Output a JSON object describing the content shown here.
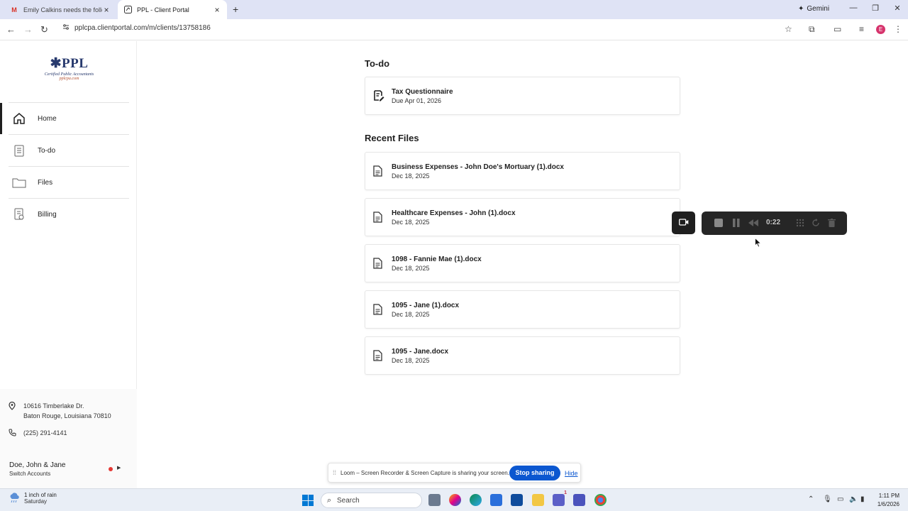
{
  "browser": {
    "tabs": [
      {
        "title": "Emily Calkins needs the followi",
        "favicon": "gmail-icon",
        "active": false
      },
      {
        "title": "PPL - Client Portal",
        "favicon": "portal-icon",
        "active": true
      }
    ],
    "gemini_label": "Gemini",
    "url": "pplcpa.clientportal.com/m/clients/13758186",
    "profile_initial": "E"
  },
  "sidebar": {
    "logo": {
      "mark": "PPL",
      "subtitle": "Certified Public Accountants",
      "site": "pplcpa.com"
    },
    "nav": [
      {
        "label": "Home",
        "icon": "home-icon",
        "active": true
      },
      {
        "label": "To-do",
        "icon": "clipboard-icon",
        "active": false
      },
      {
        "label": "Files",
        "icon": "folder-icon",
        "active": false
      },
      {
        "label": "Billing",
        "icon": "receipt-icon",
        "active": false
      }
    ],
    "address_line1": "10616 Timberlake Dr.",
    "address_line2": "Baton Rouge, Louisiana 70810",
    "phone": "(225) 291-4141",
    "account_name": "Doe, John & Jane",
    "switch_label": "Switch Accounts"
  },
  "main": {
    "todo_heading": "To-do",
    "todo_items": [
      {
        "title": "Tax Questionnaire",
        "due": "Due Apr 01, 2026"
      }
    ],
    "recent_heading": "Recent Files",
    "files": [
      {
        "name": "Business Expenses - John Doe's Mortuary (1).docx",
        "date": "Dec 18, 2025"
      },
      {
        "name": "Healthcare Expenses - John (1).docx",
        "date": "Dec 18, 2025"
      },
      {
        "name": "1098 - Fannie Mae (1).docx",
        "date": "Dec 18, 2025"
      },
      {
        "name": "1095 - Jane (1).docx",
        "date": "Dec 18, 2025"
      },
      {
        "name": "1095 - Jane.docx",
        "date": "Dec 18, 2025"
      }
    ]
  },
  "recorder": {
    "elapsed": "0:22"
  },
  "share_bar": {
    "message": "Loom – Screen Recorder & Screen Capture is sharing your screen.",
    "stop_label": "Stop sharing",
    "hide_label": "Hide"
  },
  "taskbar": {
    "weather_line1": "1 inch of rain",
    "weather_line2": "Saturday",
    "search_label": "Search",
    "time": "1:11 PM",
    "date": "1/6/2026",
    "teams_badge": "1"
  },
  "colors": {
    "accent": "#0b57d0",
    "brand": "#283a6e",
    "record": "#e53935"
  }
}
